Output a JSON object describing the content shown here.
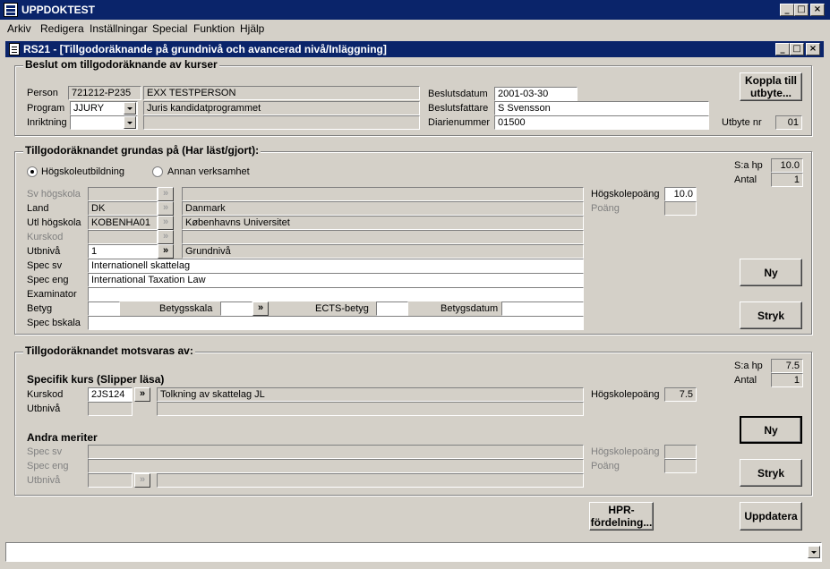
{
  "app": {
    "title": "UPPDOKTEST"
  },
  "menu": [
    "Arkiv",
    "Redigera",
    "Inställningar",
    "Special",
    "Funktion",
    "Hjälp"
  ],
  "window": {
    "title": "RS21 - [Tillgodoräknande på grundnivå och avancerad nivå/Inläggning]"
  },
  "beslut": {
    "title": "Beslut om tillgodoräknande av kurser",
    "person_label": "Person",
    "person_nr": "721212-P235",
    "person_name": "EXX TESTPERSON",
    "program_label": "Program",
    "program_code": "JJURY",
    "program_name": "Juris kandidatprogrammet",
    "inriktning_label": "Inriktning",
    "beslutsdatum_label": "Beslutsdatum",
    "beslutsdatum": "2001-03-30",
    "beslutsfattare_label": "Beslutsfattare",
    "beslutsfattare": "S Svensson",
    "diarienummer_label": "Diarienummer",
    "diarienummer": "01500",
    "koppla_label": "Koppla till utbyte...",
    "utbyte_label": "Utbyte nr",
    "utbyte_nr": "01"
  },
  "grundas": {
    "title": "Tillgodoräknandet grundas på (Har läst/gjort):",
    "radio1": "Högskoleutbildning",
    "radio2": "Annan verksamhet",
    "sahp_label": "S:a hp",
    "sahp": "10.0",
    "antal_label": "Antal",
    "antal": "1",
    "sv_hogskola_label": "Sv högskola",
    "land_label": "Land",
    "land_code": "DK",
    "land_name": "Danmark",
    "utl_label": "Utl högskola",
    "utl_code": "KOBENHA01",
    "utl_name": "Københavns Universitet",
    "kurskod_label": "Kurskod",
    "utbniva_label": "Utbnivå",
    "utbniva_code": "1",
    "utbniva_name": "Grundnivå",
    "spec_sv_label": "Spec sv",
    "spec_sv": "Internationell skattelag",
    "spec_eng_label": "Spec eng",
    "spec_eng": "International Taxation Law",
    "examinator_label": "Examinator",
    "betyg_label": "Betyg",
    "betygsskala_label": "Betygsskala",
    "ects_label": "ECTS-betyg",
    "betygsdatum_label": "Betygsdatum",
    "spec_bskala_label": "Spec bskala",
    "hp_label": "Högskolepoäng",
    "hp": "10.0",
    "poang_label": "Poäng",
    "ny_label": "Ny",
    "stryk_label": "Stryk"
  },
  "motsvaras": {
    "title": "Tillgodoräknandet motsvaras av:",
    "sahp_label": "S:a hp",
    "sahp": "7.5",
    "antal_label": "Antal",
    "antal": "1",
    "specifik_title": "Specifik kurs (Slipper läsa)",
    "kurskod_label": "Kurskod",
    "kurskod": "2JS124",
    "kurs_name": "Tolkning av skattelag JL",
    "utbniva_label": "Utbnivå",
    "hp_label": "Högskolepoäng",
    "hp": "7.5",
    "ny_label": "Ny",
    "stryk_label": "Stryk",
    "andra_title": "Andra meriter",
    "spec_sv_label": "Spec sv",
    "spec_eng_label": "Spec eng",
    "utbniva2_label": "Utbnivå",
    "hp2_label": "Högskolepoäng",
    "poang2_label": "Poäng",
    "ny2_label": "Ny",
    "stryk2_label": "Stryk"
  },
  "footer": {
    "hpr_label": "HPR-fördelning...",
    "uppdatera_label": "Uppdatera"
  },
  "glyphs": {
    "arrow": "»",
    "min": "_",
    "max": "□",
    "close": "×"
  }
}
